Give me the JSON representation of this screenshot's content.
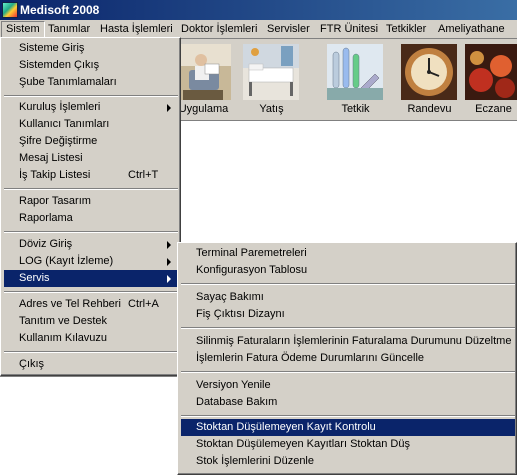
{
  "window": {
    "title": "Medisoft 2008"
  },
  "menubar": [
    "Sistem",
    "Tanımlar",
    "Hasta İşlemleri",
    "Doktor İşlemleri",
    "Servisler",
    "FTR Ünitesi",
    "Tetkikler",
    "Ameliyathane"
  ],
  "toolbar": [
    "Uygulama",
    "Yatış",
    "Tetkik",
    "Randevu",
    "Eczane"
  ],
  "sistem_menu": {
    "items": [
      {
        "label": "Sisteme Giriş"
      },
      {
        "label": "Sistemden Çıkış"
      },
      {
        "label": "Şube Tanımlamaları"
      },
      {
        "label": "Kuruluş İşlemleri",
        "submenu": true
      },
      {
        "label": "Kullanıcı Tanımları"
      },
      {
        "label": "Şifre Değiştirme"
      },
      {
        "label": "Mesaj Listesi"
      },
      {
        "label": "İş Takip Listesi",
        "shortcut": "Ctrl+T"
      },
      {
        "label": "Rapor Tasarım"
      },
      {
        "label": "Raporlama"
      },
      {
        "label": "Döviz Giriş",
        "submenu": true
      },
      {
        "label": "LOG (Kayıt İzleme)",
        "submenu": true
      },
      {
        "label": "Servis",
        "submenu": true,
        "selected": true
      },
      {
        "label": "Adres ve Tel Rehberi",
        "shortcut": "Ctrl+A"
      },
      {
        "label": "Tanıtım ve Destek"
      },
      {
        "label": "Kullanım Kılavuzu"
      },
      {
        "label": "Çıkış"
      }
    ]
  },
  "servis_submenu": {
    "items": [
      {
        "label": "Terminal Paremetreleri"
      },
      {
        "label": "Konfigurasyon Tablosu"
      },
      {
        "label": "Sayaç Bakımı"
      },
      {
        "label": "Fiş Çıktısı Dizaynı"
      },
      {
        "label": "Silinmiş Faturaların İşlemlerinin Faturalama Durumunu Düzeltme"
      },
      {
        "label": "İşlemlerin Fatura Ödeme Durumlarını Güncelle"
      },
      {
        "label": "Versiyon Yenile"
      },
      {
        "label": "Database Bakım"
      },
      {
        "label": "Stoktan Düşülemeyen Kayıt Kontrolu",
        "selected": true
      },
      {
        "label": "Stoktan Düşülemeyen Kayıtları Stoktan Düş"
      },
      {
        "label": "Stok İşlemlerini Düzenle"
      }
    ]
  },
  "colors": {
    "titlebar": "#0a246a",
    "selection": "#0a246a",
    "face": "#d4d0c8"
  }
}
